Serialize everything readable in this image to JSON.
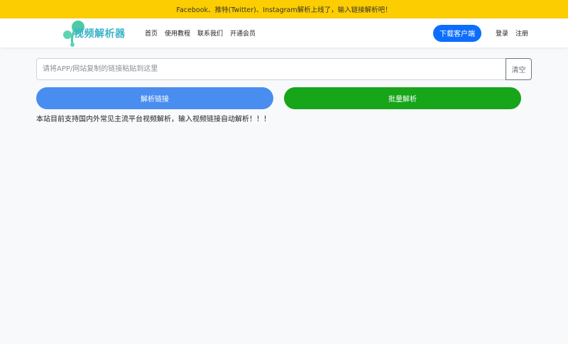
{
  "banner": {
    "text": "Facebook、推特(Twitter)、Instagram解析上线了，输入链接解析吧！"
  },
  "logo": {
    "text": "视频解析器"
  },
  "nav": {
    "links": [
      "首页",
      "使用教程",
      "联系我们",
      "开通会员"
    ],
    "download_label": "下载客户端",
    "login_label": "登录",
    "register_label": "注册"
  },
  "search": {
    "placeholder": "请将APP/网站复制的链接粘贴到这里",
    "value": "",
    "clear_label": "清空"
  },
  "actions": {
    "parse_label": "解析链接",
    "batch_label": "批量解析"
  },
  "notice": {
    "text": "本站目前支持国内外常见主流平台视频解析，输入视频链接自动解析！！！"
  },
  "colors": {
    "banner": "#fccd00",
    "primary": "#0d6efd",
    "parse": "#4a8df0",
    "batch": "#17a51a",
    "logo": "#3bb3c9"
  },
  "icons": {
    "logo_mark": "logo-bubble-icon"
  }
}
